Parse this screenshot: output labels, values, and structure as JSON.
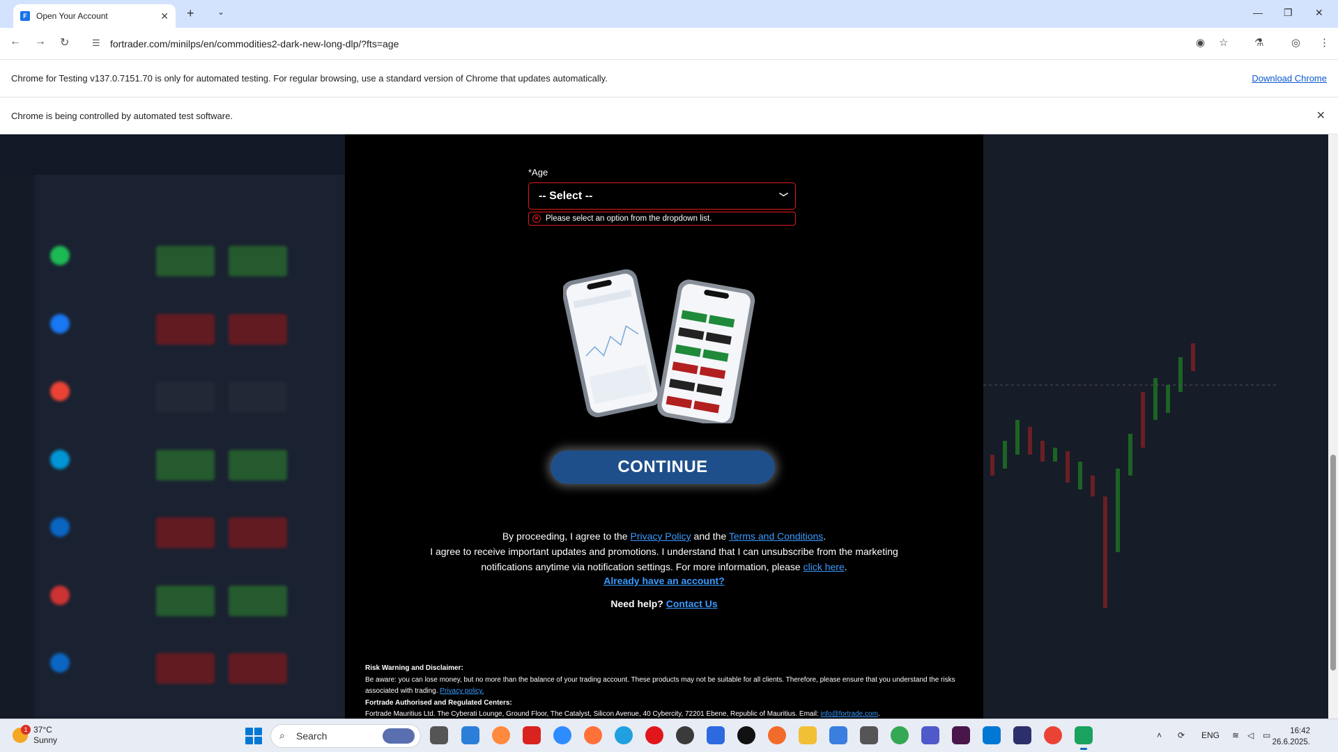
{
  "browser": {
    "tab_title": "Open Your Account",
    "tab_favicon_letter": "F",
    "url": "fortrader.com/minilps/en/commodities2-dark-new-long-dlp/?fts=age",
    "infobar_testing": "Chrome for Testing v137.0.7151.70 is only for automated testing. For regular browsing, use a standard version of Chrome that updates automatically.",
    "infobar_download": "Download Chrome",
    "infobar_automation": "Chrome is being controlled by automated test software."
  },
  "form": {
    "age_label": "*Age",
    "age_select_value": "-- Select --",
    "age_error": "Please select an option from the dropdown list.",
    "continue_label": "CONTINUE"
  },
  "legal": {
    "line1_prefix": "By proceeding, I agree to the ",
    "privacy_link": "Privacy Policy",
    "line1_mid": " and the ",
    "terms_link": "Terms and Conditions",
    "line1_suffix": ".",
    "line2": "I agree to receive important updates and promotions. I understand that I can unsubscribe from the marketing notifications anytime via notification settings. For more information, please ",
    "click_here_link": "click here",
    "line2_suffix": ".",
    "already_account_link": "Already have an account?",
    "help_label": "Need help?",
    "contact_link": "Contact Us"
  },
  "risk": {
    "title": "Risk Warning and Disclaimer:",
    "body": "Be aware: you can lose money, but no more than the balance of your trading account. These products may not be suitable for all clients. Therefore, please ensure that you understand the risks associated with trading. ",
    "privacy_link": "Privacy policy.",
    "centers_title": "Fortrade Authorised and Regulated Centers:",
    "address": "Fortrade Mauritius Ltd. The Cyberati Lounge, Ground Floor, The Catalyst, Silicon Avenue, 40 Cybercity, 72201 Ebene, Republic of Mauritius. Email: ",
    "email_link": "info@fortrade.com",
    "address_suffix": "."
  },
  "taskbar": {
    "weather_temp": "37°C",
    "weather_desc": "Sunny",
    "weather_badge": "1",
    "search_placeholder": "Search",
    "lang": "ENG",
    "time": "16:42",
    "date": "26.6.2025."
  },
  "colors": {
    "error_red": "#e01b1b",
    "link_blue": "#3b9bff",
    "continue_bg": "#1e4f8a"
  }
}
